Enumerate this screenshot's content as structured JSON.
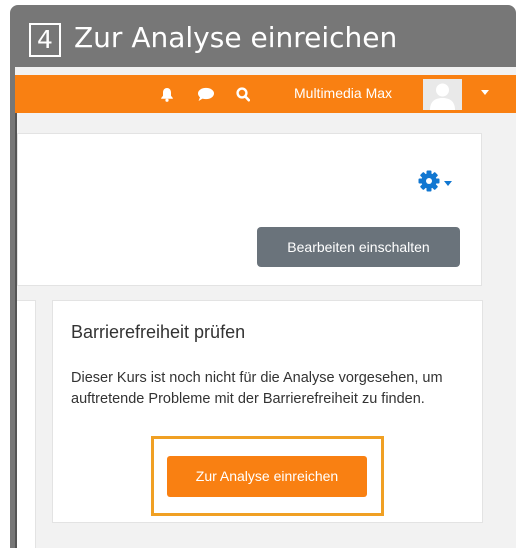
{
  "tutorial": {
    "step_number": "4",
    "step_title": "Zur Analyse einreichen"
  },
  "navbar": {
    "user_name": "Multimedia Max",
    "icons": [
      "bell-icon",
      "chat-icon",
      "search-icon"
    ]
  },
  "course_header": {
    "edit_button_label": "Bearbeiten einschalten",
    "settings_icon": "gear-icon"
  },
  "accessibility_block": {
    "heading": "Barrierefreiheit prüfen",
    "description": "Dieser Kurs ist noch nicht für die Analyse vorgesehen, um auftretende Probleme mit der Barrierefreiheit zu finden.",
    "submit_button_label": "Zur Analyse einreichen"
  },
  "colors": {
    "frame": "#777777",
    "navbar": "#f98012",
    "primary_button": "#f98012",
    "secondary_button": "#6a737b",
    "highlight": "#f0a023",
    "icon_blue": "#1177d1"
  }
}
